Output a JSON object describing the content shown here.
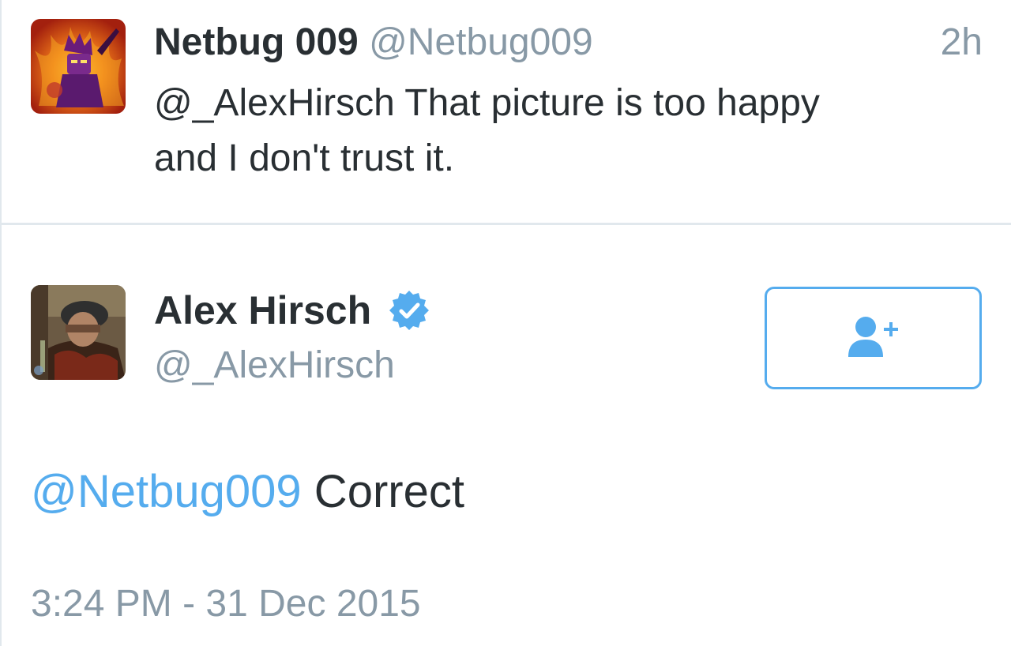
{
  "reply_tweet": {
    "display_name": "Netbug 009",
    "handle": "@Netbug009",
    "time_ago": "2h",
    "text_line1": "@_AlexHirsch That picture is too happy",
    "text_line2": "and I don't trust it.",
    "avatar_icon": "netbug-avatar"
  },
  "main_tweet": {
    "display_name": "Alex Hirsch",
    "handle": "@_AlexHirsch",
    "verified": true,
    "verified_icon": "verified-badge-icon",
    "follow_icon": "add-user-icon",
    "mention": "@Netbug009",
    "text": " Correct",
    "timestamp": "3:24 PM - 31 Dec 2015",
    "avatar_icon": "alex-avatar"
  },
  "colors": {
    "accent": "#55acee",
    "text": "#292f33",
    "muted": "#8899a6",
    "divider": "#e1e8ed"
  }
}
